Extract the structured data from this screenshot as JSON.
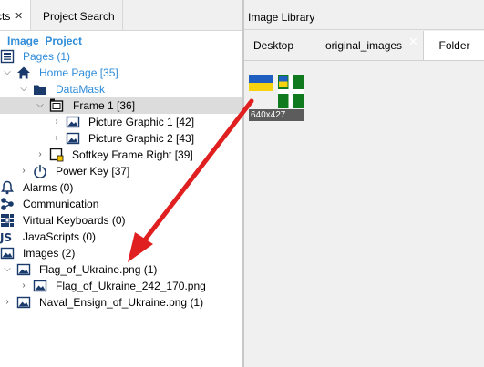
{
  "left_panel": {
    "tabs": [
      {
        "label": "cts",
        "close": "✕"
      },
      {
        "label": "Project Search"
      }
    ],
    "tree": {
      "project": "Image_Project",
      "pages": "Pages (1)",
      "home_page": "Home Page [35]",
      "datamask": "DataMask",
      "frame": "Frame 1 [36]",
      "picture1": "Picture Graphic 1 [42]",
      "picture2": "Picture Graphic 2 [43]",
      "softkey": "Softkey Frame Right [39]",
      "power_key": "Power Key [37]",
      "alarms": "Alarms (0)",
      "communication": "Communication",
      "virtual_keyboards": "Virtual Keyboards (0)",
      "javascripts": "JavaScripts (0)",
      "images": "Images (2)",
      "flag_file": "Flag_of_Ukraine.png (1)",
      "flag_variant": "Flag_of_Ukraine_242_170.png",
      "naval_file": "Naval_Ensign_of_Ukraine.png (1)"
    }
  },
  "right_panel": {
    "title": "Image Library",
    "tabs": [
      {
        "label": "Desktop"
      },
      {
        "label": "original_images",
        "close": "✕"
      },
      {
        "label": "Folder",
        "active": true
      }
    ],
    "thumbnail": {
      "size_label": "640x427"
    }
  },
  "colors": {
    "tree_blue": "#2f8cd8",
    "selection": "#dcdcdc",
    "arrow": "#e02020",
    "ukraine_blue": "#1f5fbf",
    "ukraine_yellow": "#f6d20f",
    "naval_green": "#0f7a1e"
  }
}
